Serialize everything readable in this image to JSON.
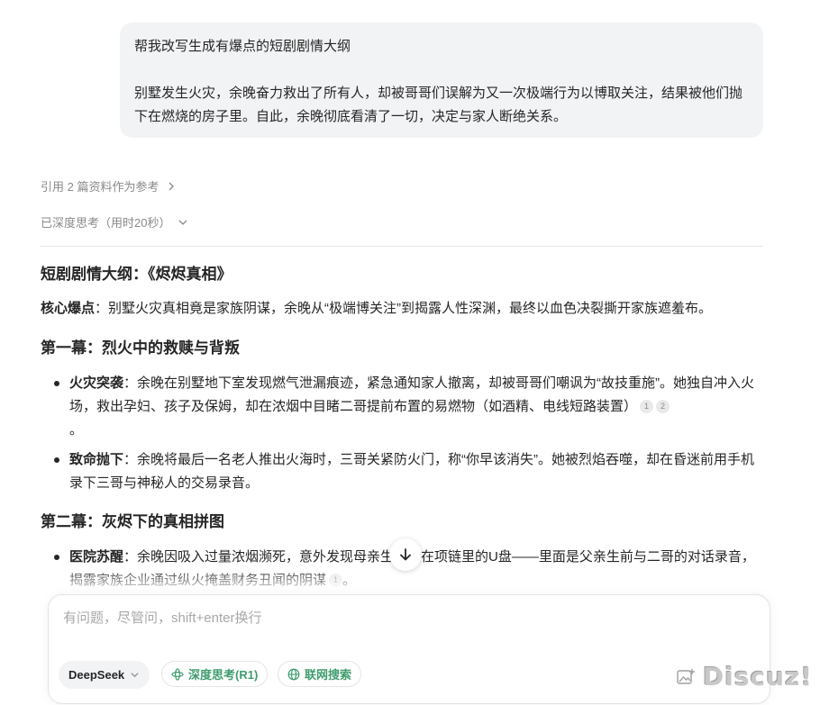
{
  "user_message": {
    "line1": "帮我改写生成有爆点的短剧剧情大纲",
    "line2": "别墅发生火灾，余晚奋力救出了所有人，却被哥哥们误解为又一次极端行为以博取关注，结果被他们抛下在燃烧的房子里。自此，余晚彻底看清了一切，决定与家人断绝关系。"
  },
  "references_label": "引用 2 篇资料作为参考",
  "thinking_label": "已深度思考（用时20秒）",
  "answer": {
    "title": "短剧剧情大纲：《烬烬真相》",
    "core_label": "核心爆点",
    "core_text": "：别墅火灾真相竟是家族阴谋，余晚从“极端博关注”到揭露人性深渊，最终以血色决裂撕开家族遮羞布。",
    "act1_heading": "第一幕：烈火中的救赎与背叛",
    "act1_items": [
      {
        "label": "火灾突袭",
        "text": "：余晚在别墅地下室发现燃气泄漏痕迹，紧急通知家人撤离，却被哥哥们嘲讽为“故技重施”。她独自冲入火场，救出孕妇、孩子及保姆，却在浓烟中目睹二哥提前布置的易燃物（如酒精、电线短路装置）",
        "cite1": "1",
        "cite2": "2",
        "tail": "。"
      },
      {
        "label": "致命抛下",
        "text": "：余晚将最后一名老人推出火海时，三哥关紧防火门，称“你早该消失”。她被烈焰吞噬，却在昏迷前用手机录下三哥与神秘人的交易录音。"
      }
    ],
    "act2_heading": "第二幕：灰烬下的真相拼图",
    "act2_items": [
      {
        "label": "医院苏醒",
        "text": "：余晚因吸入过量浓烟濒死，意外发现母亲生前藏在项链里的U盘——里面是父亲生前与二哥的对话录音，揭露家族企业通过纵火掩盖财务丑闻的阴谋",
        "cite1": "1",
        "tail": "。"
      }
    ]
  },
  "input": {
    "placeholder": "有问题，尽管问，shift+enter换行",
    "model_label": "DeepSeek",
    "deep_think_label": "深度思考(R1)",
    "web_search_label": "联网搜索"
  },
  "watermark": "Discuz!",
  "colors": {
    "accent_green": "#3f9c6e",
    "bubble_bg": "#f2f3f5",
    "muted_text": "#8a8a8a"
  }
}
